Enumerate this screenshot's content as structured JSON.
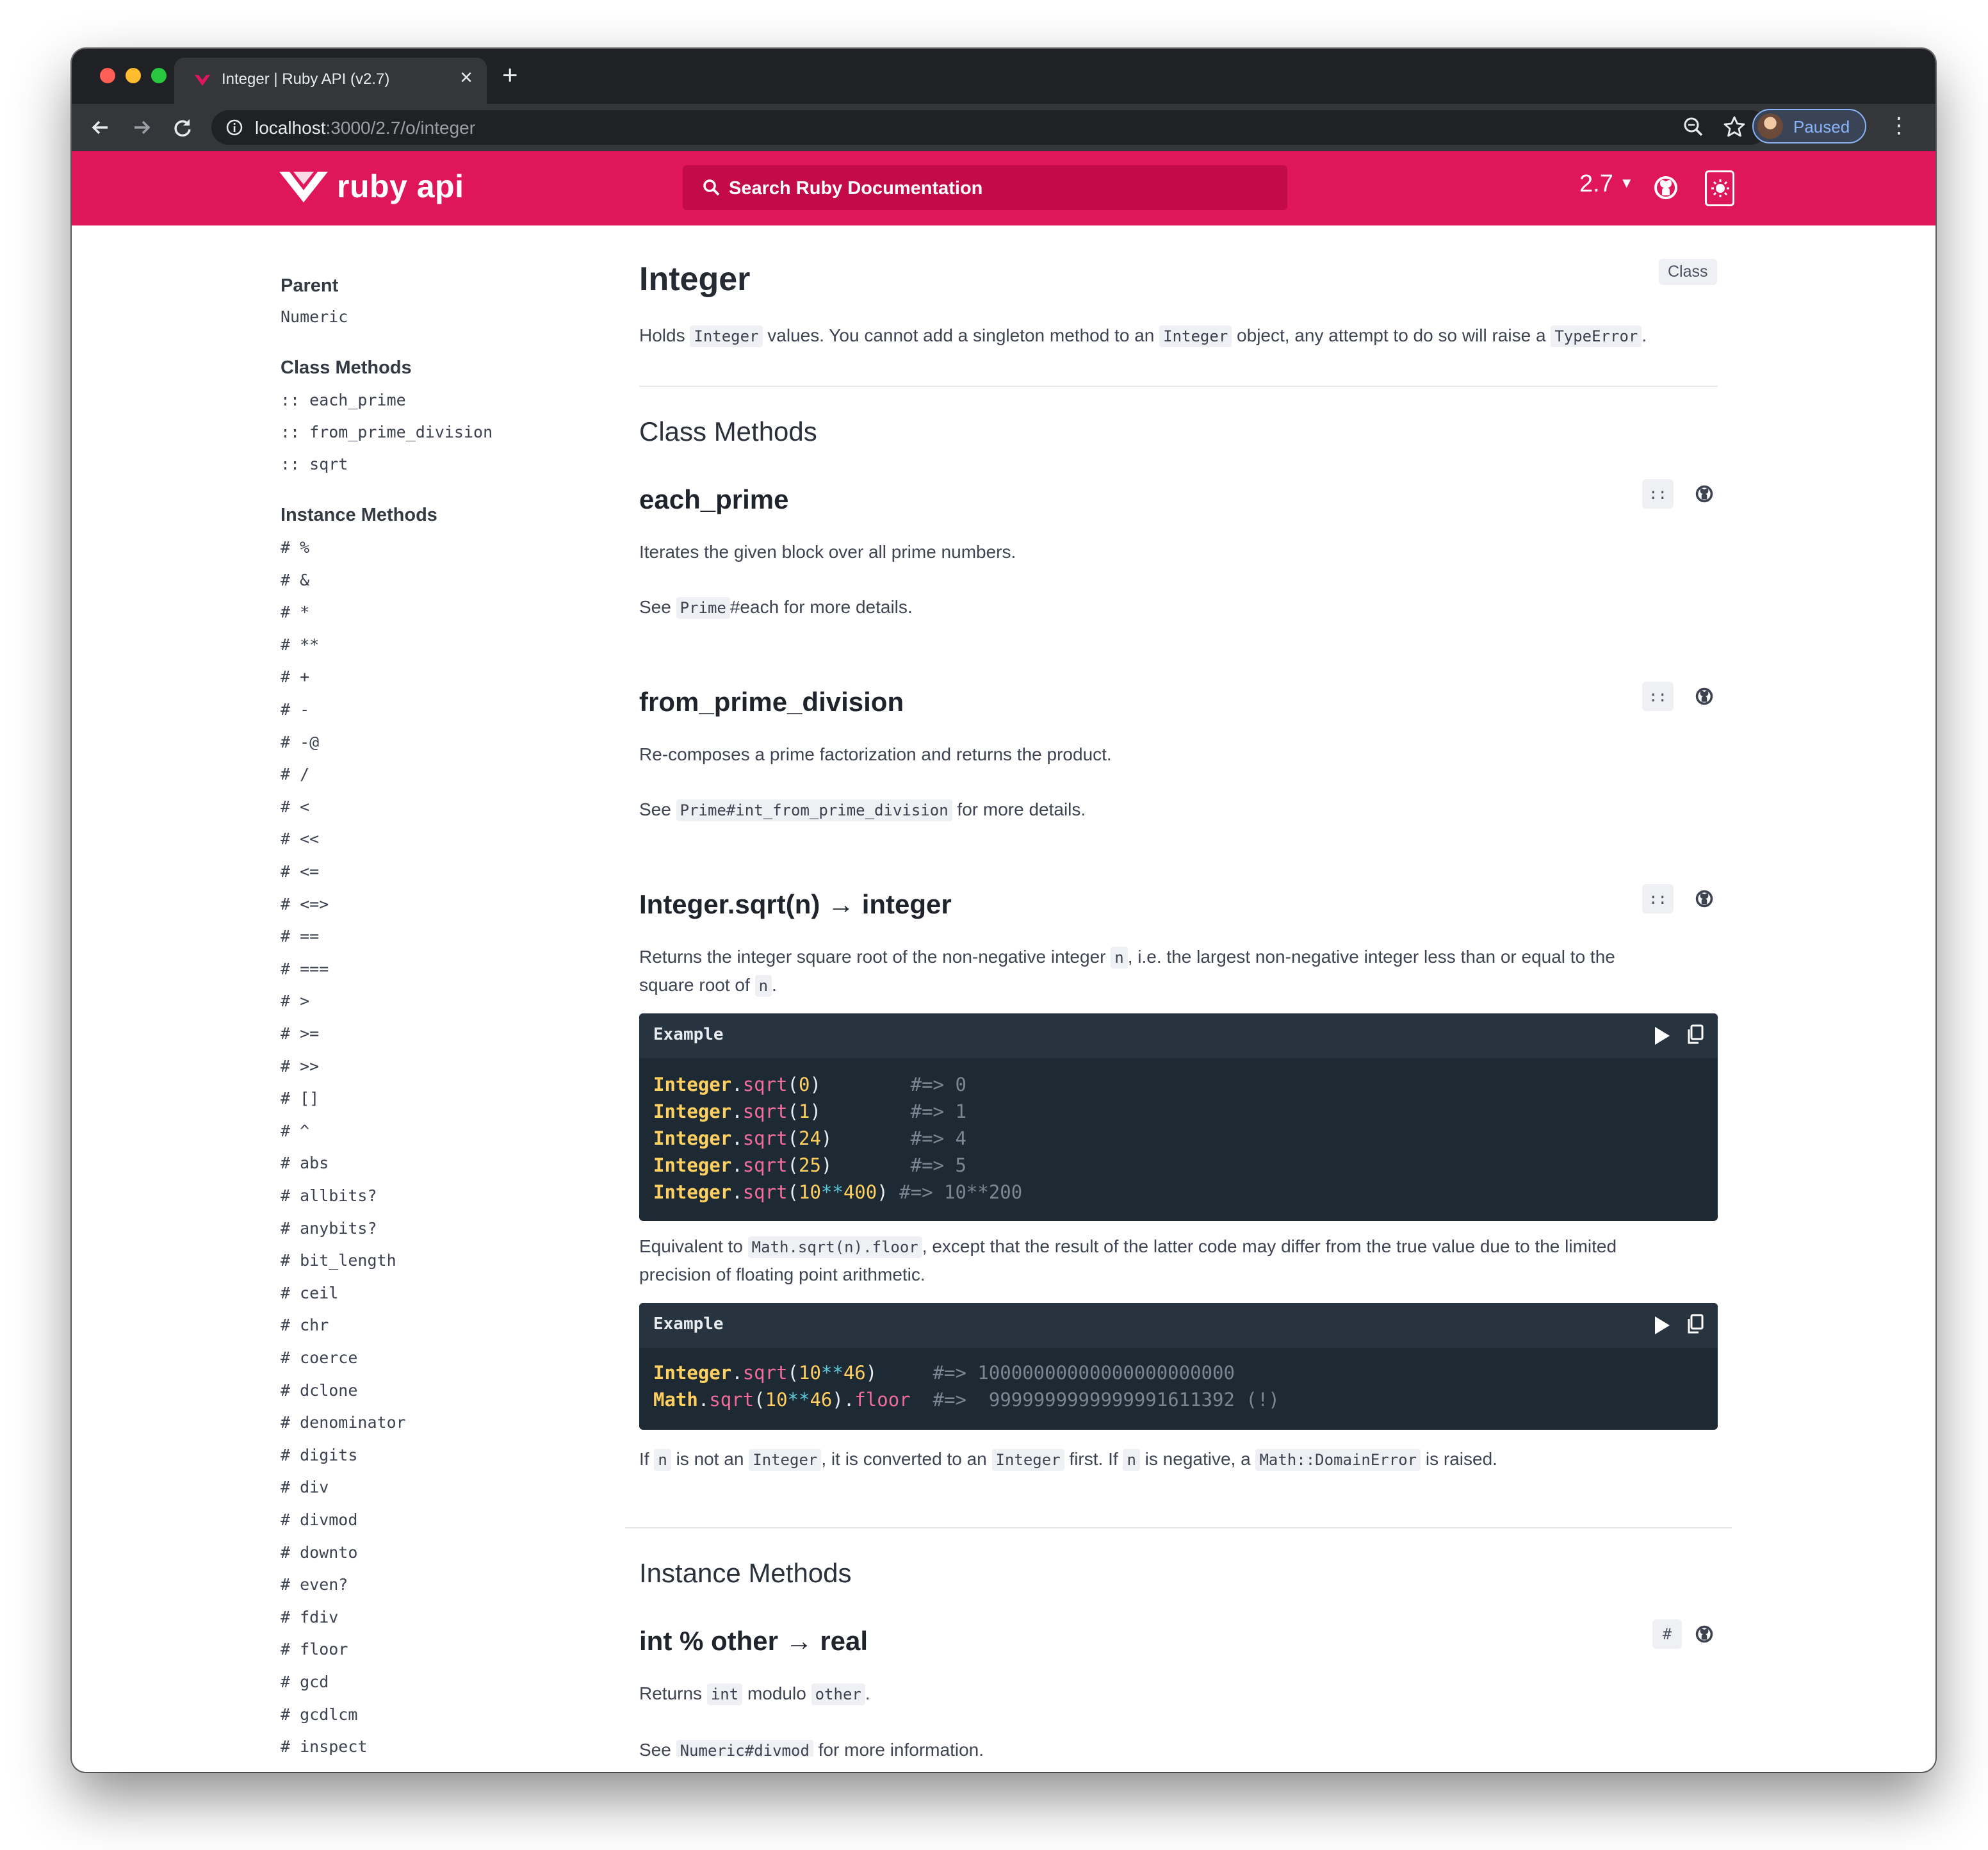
{
  "browser": {
    "tab_title": "Integer | Ruby API (v2.7)",
    "tab_close": "×",
    "new_tab": "+",
    "url_host": "localhost",
    "url_rest": ":3000/2.7/o/integer",
    "profile_label": "Paused"
  },
  "header": {
    "logo_text": "ruby api",
    "search_placeholder": "Search Ruby Documentation",
    "version": "2.7"
  },
  "sidebar": {
    "parent_heading": "Parent",
    "parent_value": "Numeric",
    "class_methods_heading": "Class Methods",
    "class_methods": [
      ":: each_prime",
      ":: from_prime_division",
      ":: sqrt"
    ],
    "instance_methods_heading": "Instance Methods",
    "instance_methods": [
      "# %",
      "# &",
      "# *",
      "# **",
      "# +",
      "# -",
      "# -@",
      "# /",
      "# <",
      "# <<",
      "# <=",
      "# <=>",
      "# ==",
      "# ===",
      "# >",
      "# >=",
      "# >>",
      "# []",
      "# ^",
      "# abs",
      "# allbits?",
      "# anybits?",
      "# bit_length",
      "# ceil",
      "# chr",
      "# coerce",
      "# dclone",
      "# denominator",
      "# digits",
      "# div",
      "# divmod",
      "# downto",
      "# even?",
      "# fdiv",
      "# floor",
      "# gcd",
      "# gcdlcm",
      "# inspect"
    ]
  },
  "main": {
    "title": "Integer",
    "badge": "Class",
    "desc": {
      "t1": "Holds ",
      "c1": "Integer",
      "t2": " values. You cannot add a singleton method to an ",
      "c2": "Integer",
      "t3": " object, any attempt to do so will raise a ",
      "c3": "TypeError",
      "t4": "."
    },
    "class_methods_heading": "Class Methods",
    "each_prime": {
      "title": "each_prime",
      "scope_btn": "::",
      "p1": "Iterates the given block over all prime numbers.",
      "see": "See ",
      "see_code": "Prime",
      "see_rest": "#each for more details."
    },
    "from_prime_division": {
      "title": "from_prime_division",
      "scope_btn": "::",
      "p1": "Re-composes a prime factorization and returns the product.",
      "see": "See ",
      "see_code": "Prime#int_from_prime_division",
      "see_rest": " for more details."
    },
    "sqrt": {
      "title": "Integer.sqrt(n) → integer",
      "scope_btn": "::",
      "p1_a": "Returns the integer square root of the non-negative integer ",
      "p1_code": "n",
      "p1_b": ", i.e. the largest non-negative integer less than or equal to the",
      "p2_a": "square root of ",
      "p2_code": "n",
      "p2_b": ".",
      "example_label": "Example",
      "ex1": {
        "const": "Integer",
        "dot": ".",
        "meth": "sqrt",
        "open": "(",
        "close": ")",
        "lines": [
          {
            "arg": "0",
            "pad": "        ",
            "cmt": "#=> 0"
          },
          {
            "arg": "1",
            "pad": "        ",
            "cmt": "#=> 1"
          },
          {
            "arg": "24",
            "pad": "       ",
            "cmt": "#=> 4"
          },
          {
            "arg": "25",
            "pad": "       ",
            "cmt": "#=> 5"
          }
        ],
        "last_a": "10",
        "last_op": "**",
        "last_b": "400",
        "last_cmt": " #=> 10**200"
      },
      "p3_a": "Equivalent to ",
      "p3_code": "Math.sqrt(n).floor",
      "p3_b": ", except that the result of the latter code may differ from the true value due to the limited",
      "p4": "precision of floating point arithmetic.",
      "ex2": {
        "l1_const": "Integer",
        "l1_meth": "sqrt",
        "l1_a": "10",
        "l1_op": "**",
        "l1_b": "46",
        "l1_cmt": "     #=> 10000000000000000000000",
        "l2_const": "Math",
        "l2_meth": "sqrt",
        "l2_a": "10",
        "l2_op": "**",
        "l2_b": "46",
        "l2_tail": "floor",
        "l2_cmt": "  #=>  9999999999999991611392 (!)"
      },
      "p5_a": "If ",
      "p5_c1": "n",
      "p5_b": " is not an ",
      "p5_c2": "Integer",
      "p5_c": ", it is converted to an ",
      "p5_c3": "Integer",
      "p5_d": " first. If ",
      "p5_c4": "n",
      "p5_e": " is negative, a ",
      "p5_c5": "Math::DomainError",
      "p5_f": " is raised."
    },
    "instance_methods_heading": "Instance Methods",
    "modulo": {
      "title": "int % other → real",
      "scope_btn": "#",
      "p1_a": "Returns ",
      "p1_c1": "int",
      "p1_b": " modulo ",
      "p1_c2": "other",
      "p1_c": ".",
      "see": "See ",
      "see_code": "Numeric#divmod",
      "see_rest": " for more information."
    }
  }
}
